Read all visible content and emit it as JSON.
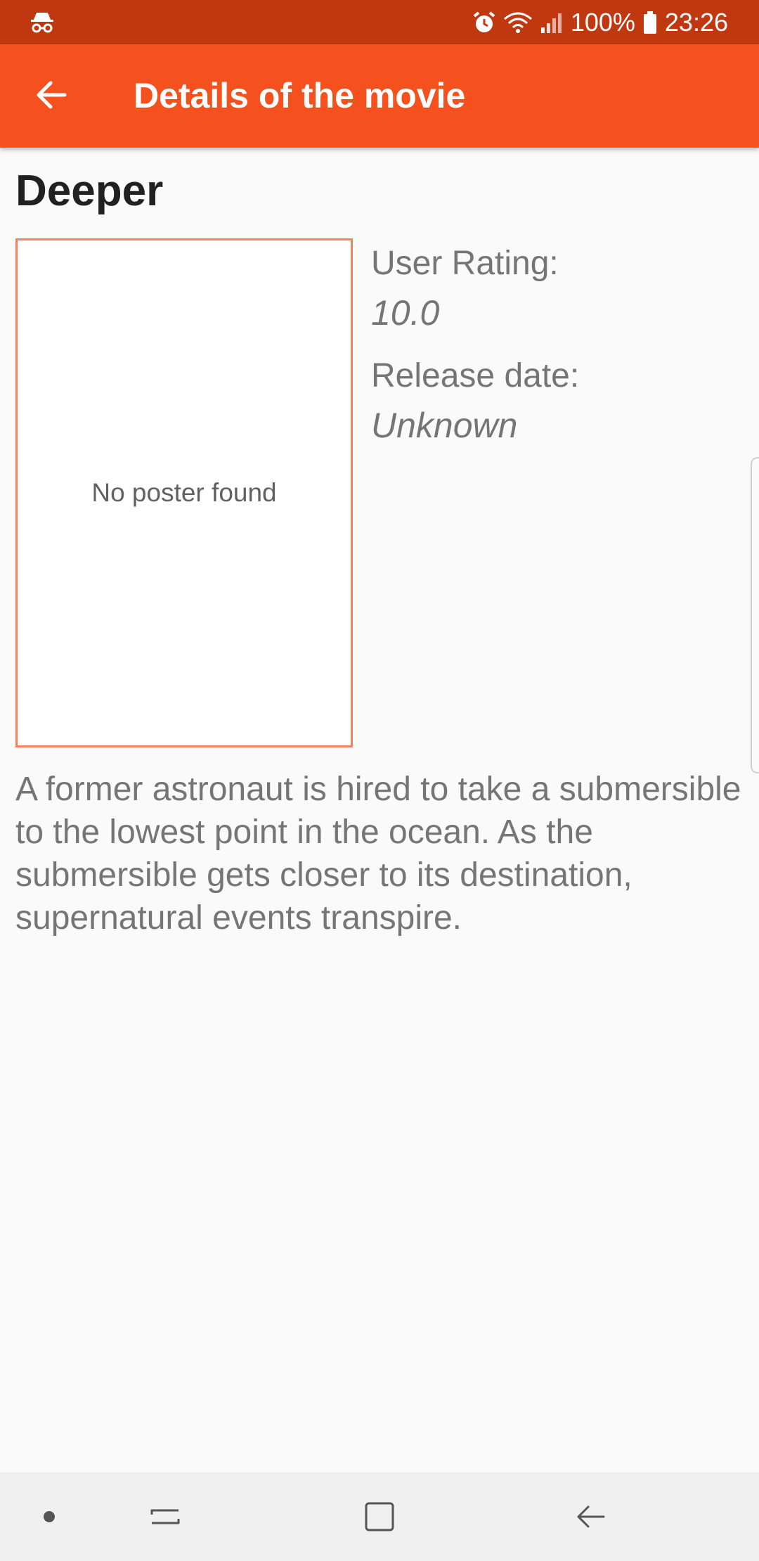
{
  "status_bar": {
    "battery": "100%",
    "time": "23:26",
    "icons": [
      "incognito-icon",
      "alarm-icon",
      "wifi-icon",
      "signal-icon",
      "battery-icon"
    ]
  },
  "app_bar": {
    "title": "Details of the movie",
    "back_icon": "arrow-back-icon",
    "color": "#f4511e",
    "status_color": "#c0380f"
  },
  "movie": {
    "title": "Deeper",
    "poster_placeholder": "No poster found",
    "rating_label": "User Rating:",
    "rating_value": "10.0",
    "release_label": "Release date:",
    "release_value": "Unknown",
    "overview": "A former astronaut is hired to take a submersible to the lowest point in the ocean. As the submersible gets closer to its destination, supernatural events transpire."
  },
  "nav_bar": {
    "items": [
      "dot-icon",
      "recents-icon",
      "home-icon",
      "back-icon"
    ]
  }
}
